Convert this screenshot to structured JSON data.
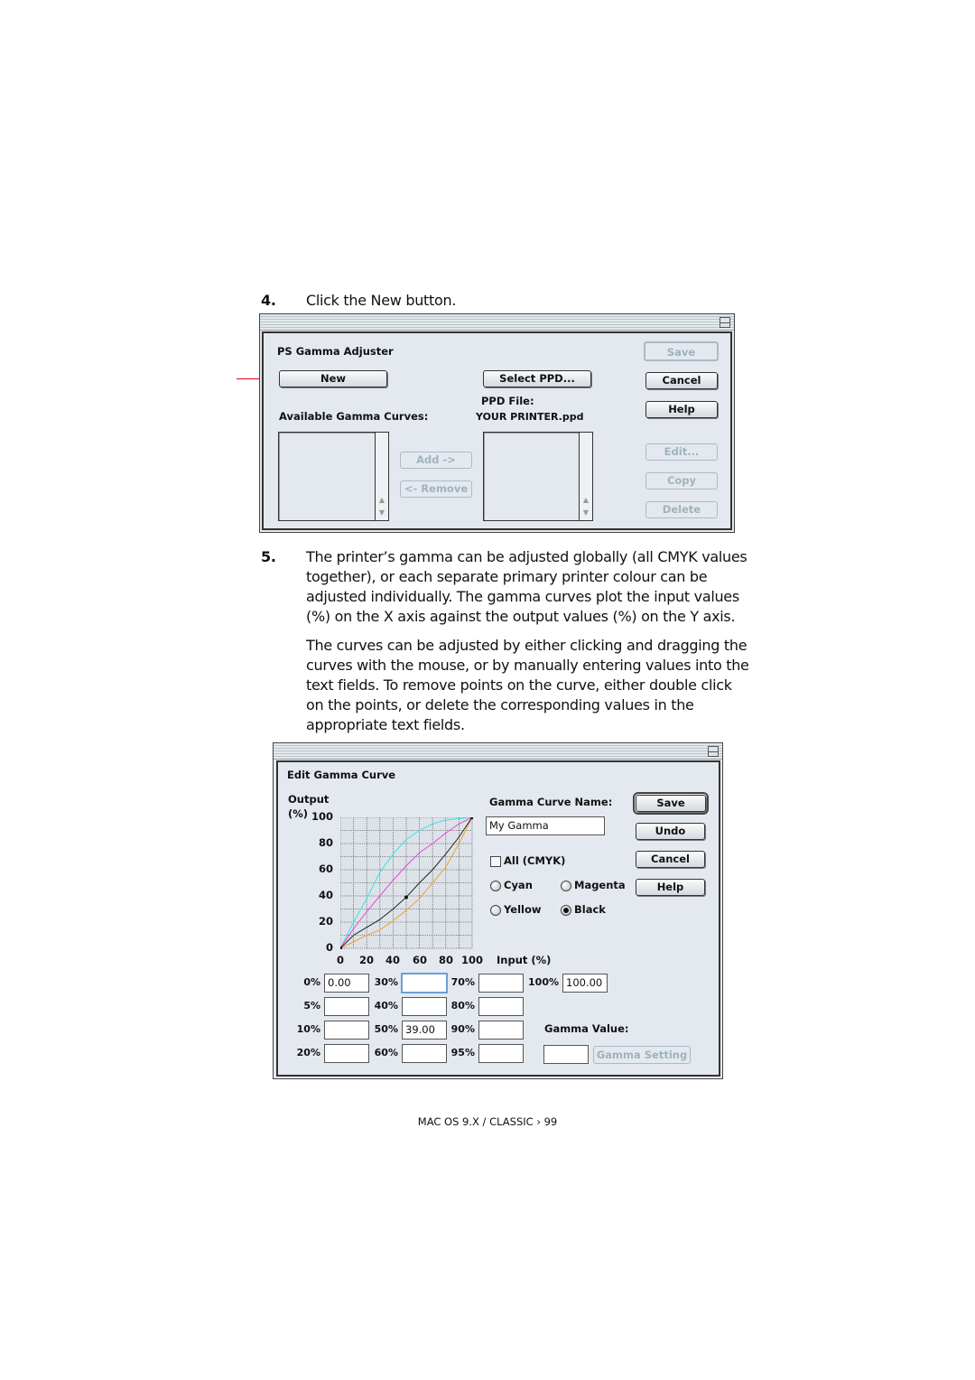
{
  "step4": {
    "number": "4.",
    "text": "Click the New button."
  },
  "dialog1": {
    "title": "PS Gamma Adjuster",
    "new_label": "New",
    "select_ppd_label": "Select PPD...",
    "save_label": "Save",
    "cancel_label": "Cancel",
    "help_label": "Help",
    "ppd_file_label": "PPD File:",
    "ppd_file_value": "YOUR PRINTER.ppd",
    "available_label": "Available Gamma Curves:",
    "add_label": "Add ->",
    "remove_label": "<- Remove",
    "edit_label": "Edit...",
    "copy_label": "Copy",
    "delete_label": "Delete",
    "callout_color": "#e0001b"
  },
  "step5": {
    "number": "5.",
    "para1": [
      "The printer’s gamma can be adjusted globally (all CMYK values",
      "together), or each separate primary printer colour can be",
      "adjusted individually. The gamma curves plot the input values",
      "(%) on the X axis against the output values (%) on the Y axis."
    ],
    "para2": [
      "The curves can be adjusted by either clicking and dragging the",
      "curves with the mouse, or by manually entering values into the",
      "text fields. To remove points on the curve, either double click",
      "on the points, or delete the corresponding values in the",
      "appropriate text fields."
    ]
  },
  "dialog2": {
    "title": "Edit Gamma Curve",
    "output_label": "Output",
    "output_unit": "(%)",
    "input_label": "Input (%)",
    "y_ticks": [
      "100",
      "80",
      "60",
      "40",
      "20",
      "0"
    ],
    "x_ticks": [
      "0",
      "20",
      "40",
      "60",
      "80",
      "100"
    ],
    "curve_name_label": "Gamma Curve Name:",
    "curve_name_value": "My Gamma",
    "save_label": "Save",
    "undo_label": "Undo",
    "cancel_label": "Cancel",
    "help_label": "Help",
    "all_cmyk_label": "All (CMYK)",
    "all_cmyk_checked": false,
    "radios": [
      {
        "label": "Cyan",
        "selected": false
      },
      {
        "label": "Magenta",
        "selected": false
      },
      {
        "label": "Yellow",
        "selected": false
      },
      {
        "label": "Black",
        "selected": true
      }
    ],
    "fields": [
      {
        "label": "0%",
        "value": "0.00"
      },
      {
        "label": "5%",
        "value": ""
      },
      {
        "label": "10%",
        "value": ""
      },
      {
        "label": "20%",
        "value": ""
      },
      {
        "label": "30%",
        "value": ""
      },
      {
        "label": "40%",
        "value": ""
      },
      {
        "label": "50%",
        "value": "39.00"
      },
      {
        "label": "60%",
        "value": ""
      },
      {
        "label": "70%",
        "value": ""
      },
      {
        "label": "80%",
        "value": ""
      },
      {
        "label": "90%",
        "value": ""
      },
      {
        "label": "95%",
        "value": ""
      },
      {
        "label": "100%",
        "value": "100.00"
      }
    ],
    "gamma_value_label": "Gamma Value:",
    "gamma_value": "",
    "gamma_setting_label": "Gamma Setting",
    "curves": [
      {
        "color": "#33e6e6",
        "points": [
          [
            0,
            0
          ],
          [
            10,
            20
          ],
          [
            20,
            38
          ],
          [
            30,
            58
          ],
          [
            40,
            72
          ],
          [
            50,
            83
          ],
          [
            60,
            90
          ],
          [
            70,
            95
          ],
          [
            80,
            98
          ],
          [
            100,
            100
          ]
        ]
      },
      {
        "color": "#ee44dd",
        "points": [
          [
            0,
            0
          ],
          [
            10,
            15
          ],
          [
            20,
            28
          ],
          [
            30,
            40
          ],
          [
            40,
            52
          ],
          [
            50,
            63
          ],
          [
            60,
            73
          ],
          [
            70,
            80
          ],
          [
            80,
            88
          ],
          [
            90,
            95
          ],
          [
            100,
            100
          ]
        ]
      },
      {
        "color": "#f0a030",
        "points": [
          [
            0,
            0
          ],
          [
            10,
            5
          ],
          [
            20,
            10
          ],
          [
            30,
            14
          ],
          [
            40,
            21
          ],
          [
            50,
            29
          ],
          [
            60,
            38
          ],
          [
            70,
            50
          ],
          [
            80,
            62
          ],
          [
            90,
            80
          ],
          [
            100,
            100
          ]
        ]
      },
      {
        "color": "#222222",
        "points": [
          [
            0,
            0
          ],
          [
            10,
            10
          ],
          [
            20,
            16
          ],
          [
            30,
            22
          ],
          [
            40,
            30
          ],
          [
            50,
            39
          ],
          [
            60,
            50
          ],
          [
            70,
            60
          ],
          [
            80,
            72
          ],
          [
            90,
            85
          ],
          [
            100,
            100
          ]
        ]
      }
    ]
  },
  "footer": "MAC OS 9.X / CLASSIC › 99"
}
